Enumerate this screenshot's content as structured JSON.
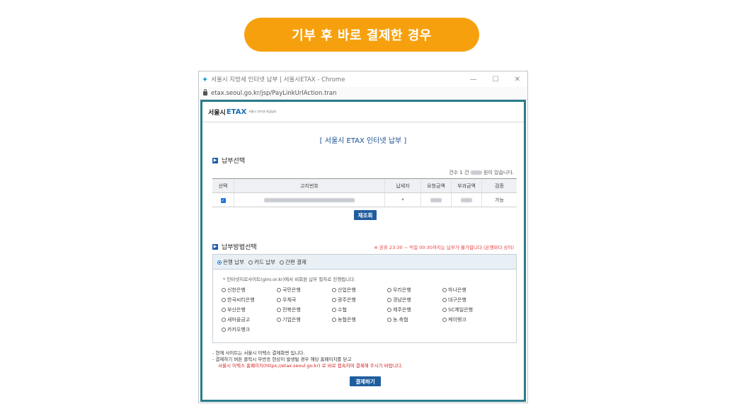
{
  "banner": {
    "label": "기부 후 바로 결제한 경우"
  },
  "window": {
    "title": "서울시 지방세 인터넷 납부 | 서울시ETAX - Chrome",
    "url": "etax.seoul.go.kr/jsp/PayLinkUrlAction.tran",
    "minimize": "—",
    "maximize": "☐",
    "close": "✕"
  },
  "site": {
    "brand_prefix": "서울시",
    "brand_name": "ETAX",
    "brand_sub": "서울시 인터넷 세금납부",
    "page_title": "[ 서울시 ETAX 인터넷 납부 ]"
  },
  "selection": {
    "section_title": "납부선택",
    "count_prefix": "건수 1 건",
    "count_suffix": "원이 있습니다.",
    "columns": [
      "선택",
      "고지번호",
      "납세자",
      "요청금액",
      "부과금액",
      "검증"
    ],
    "row": {
      "taxpayer": "*",
      "status": "가능"
    },
    "refresh_label": "재조회"
  },
  "method": {
    "section_title": "납부방법선택",
    "warning": "※ 공휴 23:30 ~ 익일 00:30까지는 납부가 불가합니다 (은행마다 상이)",
    "tabs": [
      "은행 납부",
      "카드 납부",
      "간편 결제"
    ],
    "note": "* 인터넷지로사이트(giro.or.kr)에서 비회원 납부 절차로 진행됩니다.",
    "banks": [
      "신한은행",
      "국민은행",
      "산업은행",
      "우리은행",
      "하나은행",
      "한국씨티은행",
      "우체국",
      "광주은행",
      "경남은행",
      "대구은행",
      "부산은행",
      "전북은행",
      "수협",
      "제주은행",
      "SC제일은행",
      "새마을금고",
      "기업은행",
      "농협은행",
      "농.축협",
      "케이뱅크",
      "카카오뱅크"
    ]
  },
  "footer": {
    "line1": "- 현재 사이트는 서울시 이택스 결제화면 입니다.",
    "line2": "- 결제하기 버튼 클릭시 무반응 현상이 발생될 경우 해당 홈페이지를 닫고",
    "line3": "서울시 이택스 홈페이지(https://etax.seoul.go.kr) 로 바로 접속하여 결제해 주시기 바랍니다.",
    "pay_label": "결제하기"
  },
  "colors": {
    "banner": "#f7a00e",
    "frame": "#2b7c8c",
    "button": "#1f5d9e",
    "warning": "#e63b3b"
  }
}
